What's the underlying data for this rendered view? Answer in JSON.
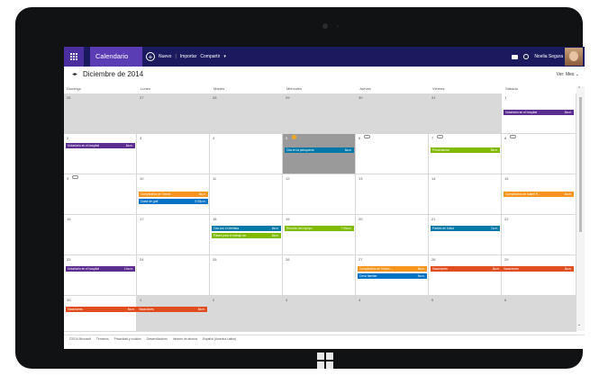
{
  "header": {
    "app_name": "Calendario",
    "new_label": "Nuevo",
    "import_label": "Importar",
    "share_label": "Compartir",
    "user_name": "Noelia Segura"
  },
  "toolbar": {
    "month_title": "Diciembre de 2014",
    "view_label": "Ver: Mes"
  },
  "weekdays": [
    "Domingo",
    "Lunes",
    "Martes",
    "Miércoles",
    "Jueves",
    "Viernes",
    "Sábado"
  ],
  "weeks": [
    [
      "26",
      "27",
      "28",
      "29",
      "30",
      "31",
      "1"
    ],
    [
      "2",
      "3",
      "4",
      "5",
      "6",
      "7",
      "8"
    ],
    [
      "9",
      "10",
      "11",
      "12",
      "13",
      "14",
      "15"
    ],
    [
      "16",
      "17",
      "18",
      "19",
      "20",
      "21",
      "22"
    ],
    [
      "23",
      "24",
      "25",
      "26",
      "27",
      "28",
      "29"
    ],
    [
      "30",
      "1",
      "2",
      "3",
      "4",
      "5",
      "6"
    ]
  ],
  "events": {
    "w0_sat": {
      "title": "Voluntario en el hospital",
      "time": "8a.m."
    },
    "w1_sun": {
      "title": "Voluntario en el hospital",
      "time": "8a.m."
    },
    "w1_wed": {
      "title": "Cita en la peluquería",
      "time": "8a.m."
    },
    "w1_fri": {
      "title": "Presentación",
      "time": "8a.m."
    },
    "w2_mon1": {
      "title": "Cumpleaños de Gerda ...",
      "time": "8a.m."
    },
    "w2_mon2": {
      "title": "Clase de golf",
      "time": "3:30p.m."
    },
    "w2_sat": {
      "title": "Cumpleaños de Isabel R...",
      "time": "8a.m."
    },
    "w3_tue1": {
      "title": "Cita con el dentista",
      "time": "8a.m."
    },
    "w3_tue2": {
      "title": "Pasea para el trabajo de...",
      "time": "8a.m."
    },
    "w3_wed": {
      "title": "Reunión del equipo",
      "time": "7:30a.m."
    },
    "w3_fri": {
      "title": "Partido de fútbol",
      "time": "7a.m."
    },
    "w4_sun": {
      "title": "Voluntario en el hospital",
      "time": "10a.m."
    },
    "w4_thu1": {
      "title": "Cumpleaños de Vinicio ...",
      "time": "8a.m."
    },
    "w4_thu2": {
      "title": "Cena familiar",
      "time": "8a.m."
    },
    "w4_fri": {
      "title": "Vacaciones",
      "time": "8a.m."
    },
    "w4_sat": {
      "title": "Vacaciones",
      "time": "8a.m."
    },
    "w5_sun": {
      "title": "Vacaciones",
      "time": "8a.m."
    },
    "w5_mon": {
      "title": "Vacaciones",
      "time": "8a.m."
    }
  },
  "footer": [
    "©2014 Microsoft",
    "Términos",
    "Privacidad y cookies",
    "Desarrolladores",
    "Informe de abusos",
    "Español (América Latina)"
  ],
  "colors": {
    "header_bg": "#1b1a5e",
    "app_tile": "#5a3db5",
    "purple": "#5c2d91",
    "orange": "#f7941d",
    "blue": "#0072c6",
    "green": "#7fba00",
    "red": "#e04e1f"
  }
}
